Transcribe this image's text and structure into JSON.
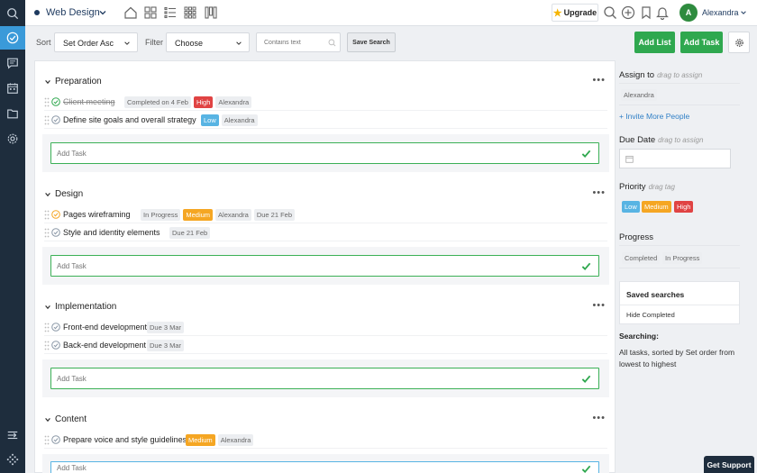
{
  "topbar": {
    "project_name": "Web Design",
    "upgrade_label": "Upgrade",
    "user_initial": "A",
    "user_name": "Alexandra"
  },
  "toolbar": {
    "sort_label": "Sort",
    "sort_value": "Set Order Asc",
    "filter_label": "Filter",
    "filter_value": "Choose",
    "search_placeholder": "Contains text",
    "save_search_label": "Save Search",
    "add_list_label": "Add List",
    "add_task_label": "Add Task"
  },
  "add_task_placeholder": "Add Task",
  "lists": [
    {
      "title": "Preparation",
      "tasks": [
        {
          "name": "Client meeting",
          "done": true,
          "tags": [
            {
              "text": "Completed on 4 Feb",
              "style": "grey"
            },
            {
              "text": "High",
              "style": "red"
            },
            {
              "text": "Alexandra",
              "style": "grey"
            }
          ]
        },
        {
          "name": "Define site goals and overall strategy",
          "done": false,
          "tags": [
            {
              "text": "Low",
              "style": "blue"
            },
            {
              "text": "Alexandra",
              "style": "grey"
            }
          ]
        }
      ]
    },
    {
      "title": "Design",
      "tasks": [
        {
          "name": "Pages wireframing",
          "done": false,
          "in_progress": true,
          "tags": [
            {
              "text": "In Progress",
              "style": "grey"
            },
            {
              "text": "Medium",
              "style": "orange"
            },
            {
              "text": "Alexandra",
              "style": "grey"
            },
            {
              "text": "Due 21 Feb",
              "style": "grey"
            }
          ]
        },
        {
          "name": "Style and identity elements",
          "done": false,
          "tags": [
            {
              "text": "Due 21 Feb",
              "style": "grey"
            }
          ]
        }
      ]
    },
    {
      "title": "Implementation",
      "tasks": [
        {
          "name": "Front-end development",
          "done": false,
          "tags": [
            {
              "text": "Due 3 Mar",
              "style": "grey"
            }
          ]
        },
        {
          "name": "Back-end development",
          "done": false,
          "tags": [
            {
              "text": "Due 3 Mar",
              "style": "grey"
            }
          ]
        }
      ]
    },
    {
      "title": "Content",
      "tasks": [
        {
          "name": "Prepare voice and style guidelines",
          "done": false,
          "tags": [
            {
              "text": "Medium",
              "style": "orange"
            },
            {
              "text": "Alexandra",
              "style": "grey"
            }
          ]
        }
      ]
    }
  ],
  "side": {
    "assign_title": "Assign to",
    "assign_hint": "drag to assign",
    "assign_user": "Alexandra",
    "invite_label": "+ Invite More People",
    "due_title": "Due Date",
    "due_hint": "drag to assign",
    "priority_title": "Priority",
    "priority_hint": "drag tag",
    "priority_low": "Low",
    "priority_medium": "Medium",
    "priority_high": "High",
    "progress_title": "Progress",
    "progress_completed": "Completed",
    "progress_in_progress": "In Progress",
    "saved_title": "Saved searches",
    "saved_item": "Hide Completed",
    "searching_title": "Searching:",
    "searching_text": "All tasks, sorted by Set order from lowest to highest"
  },
  "support_label": "Get Support",
  "colors": {
    "rail": "#1e2d3d",
    "rail_active": "#3a9ad9",
    "accent_green": "#2fa84f",
    "tag_red": "#e04343",
    "tag_blue": "#58b4e3",
    "tag_orange": "#f5a623"
  }
}
